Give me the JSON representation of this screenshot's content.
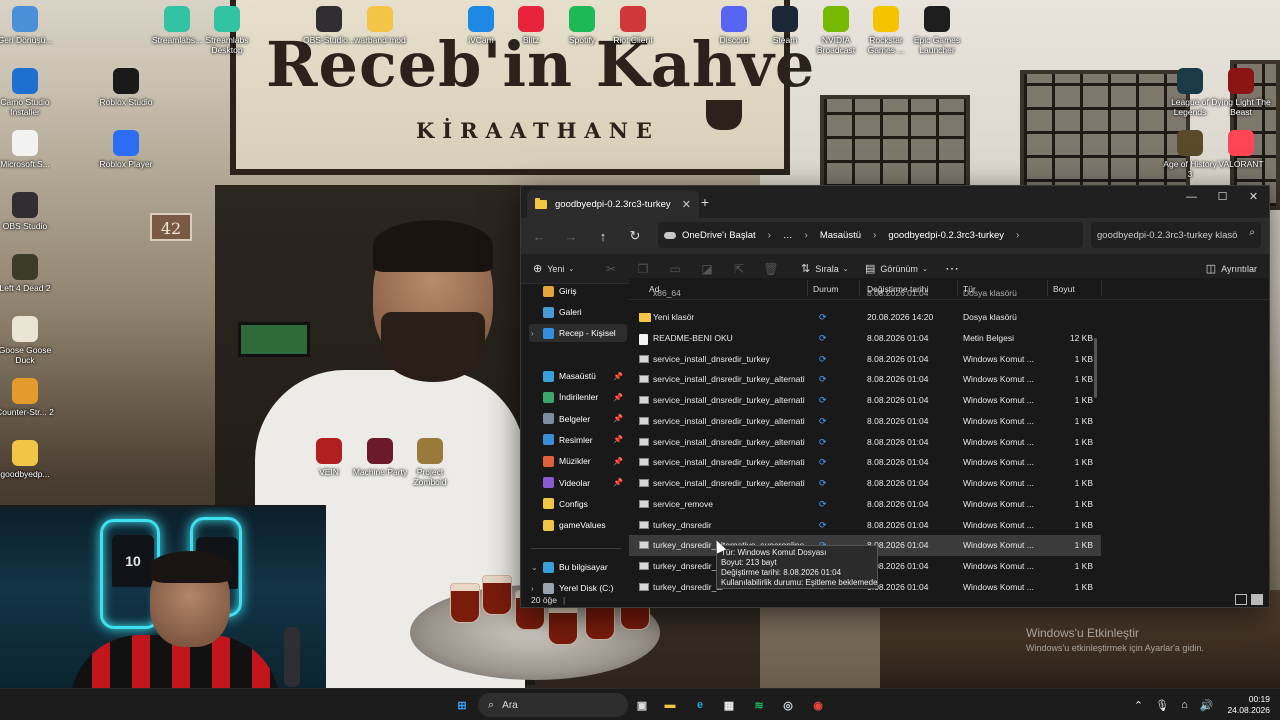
{
  "desktop": {
    "icons_left": [
      {
        "label": "Geri Dönüşü...",
        "icon": "recycle-bin-icon",
        "color": "#4a90d9"
      },
      {
        "label": "Camo Studio Installer",
        "icon": "download-icon",
        "color": "#1f6fd1"
      },
      {
        "label": "Microsoft.S...",
        "icon": "document-icon",
        "color": "#f2f2f2"
      },
      {
        "label": "OBS Studio",
        "icon": "obs-icon",
        "color": "#302e31"
      },
      {
        "label": "Left 4 Dead 2",
        "icon": "left4dead-icon",
        "color": "#3c3c2a"
      },
      {
        "label": "Goose Goose Duck",
        "icon": "goose-icon",
        "color": "#e9e4d3"
      },
      {
        "label": "Counter-Str... 2",
        "icon": "counter-strike-icon",
        "color": "#e39b2b"
      },
      {
        "label": "goodbyedp...",
        "icon": "folder-icon",
        "color": "#f2c546"
      }
    ],
    "icons_col2": [
      {
        "label": "Roblox Studio",
        "icon": "roblox-studio-icon",
        "color": "#1a1a1a"
      },
      {
        "label": "Roblox Player",
        "icon": "roblox-player-icon",
        "color": "#2d6cf5"
      }
    ],
    "icons_top": [
      {
        "label": "Streamlabs...",
        "icon": "streamlabs-icon",
        "color": "#31c3a2"
      },
      {
        "label": "Streamlabs Desktop",
        "icon": "streamlabs-desktop-icon",
        "color": "#31c3a2"
      },
      {
        "label": "OBS-Studio...",
        "icon": "obs-icon",
        "color": "#302e31"
      },
      {
        "label": "warband mod",
        "icon": "folder-icon",
        "color": "#f2c546"
      },
      {
        "label": "iVCam",
        "icon": "ivcam-icon",
        "color": "#1e88e5"
      },
      {
        "label": "Blitz",
        "icon": "blitz-icon",
        "color": "#e8233c"
      },
      {
        "label": "Spotify",
        "icon": "spotify-icon",
        "color": "#1db954"
      },
      {
        "label": "Riot Client",
        "icon": "riot-icon",
        "color": "#d13639"
      },
      {
        "label": "Discord",
        "icon": "discord-icon",
        "color": "#5865f2"
      },
      {
        "label": "Steam",
        "icon": "steam-icon",
        "color": "#1b2838"
      },
      {
        "label": "NVIDIA Broadcast",
        "icon": "nvidia-icon",
        "color": "#76b900"
      },
      {
        "label": "Rockstar Games ...",
        "icon": "rockstar-icon",
        "color": "#f5c400"
      },
      {
        "label": "Epic Games Launcher",
        "icon": "epic-games-icon",
        "color": "#1e1e1e"
      }
    ],
    "icons_right": [
      {
        "label": "League of Legends",
        "icon": "league-icon",
        "color": "#1a3a4a"
      },
      {
        "label": "Dying Light The Beast",
        "icon": "dying-light-icon",
        "color": "#8b1414"
      },
      {
        "label": "Age of History 3",
        "icon": "age-of-history-icon",
        "color": "#5a4a2a"
      },
      {
        "label": "VALORANT",
        "icon": "valorant-icon",
        "color": "#fd4556"
      }
    ],
    "icons_middle": [
      {
        "label": "VEIN",
        "icon": "vein-icon",
        "color": "#b21f1f"
      },
      {
        "label": "Machine Party",
        "icon": "machine-party-icon",
        "color": "#6a1a2a"
      },
      {
        "label": "Project Zomboid",
        "icon": "project-zomboid-icon",
        "color": "#9a7a3a"
      }
    ]
  },
  "wallpaper": {
    "sign_title": "Receb'in Kahve",
    "sign_subtitle": "KİRAATHANE",
    "door_number": "42"
  },
  "explorer": {
    "tab_title": "goodbyedpi-0.2.3rc3-turkey",
    "window_controls": {
      "minimize": "—",
      "maximize": "☐",
      "close": "✕"
    },
    "breadcrumb": [
      "OneDrive'ı Başlat",
      "…",
      "Masaüstü",
      "goodbyedpi-0.2.3rc3-turkey"
    ],
    "search_placeholder": "goodbyedpi-0.2.3rc3-turkey klasö",
    "commands": {
      "new": "Yeni",
      "sort": "Sırala",
      "view": "Görünüm",
      "more": "⋯",
      "details": "Ayrıntılar"
    },
    "sidebar": {
      "top": [
        {
          "label": "Giriş",
          "icon": "home-icon",
          "color": "#e2a33a"
        },
        {
          "label": "Galeri",
          "icon": "gallery-icon",
          "color": "#4a9ad8"
        },
        {
          "label": "Recep - Kişisel",
          "icon": "onedrive-icon",
          "color": "#2f8ee0"
        }
      ],
      "quick": [
        {
          "label": "Masaüstü",
          "icon": "desktop-icon",
          "color": "#3aa1d8",
          "pinned": true
        },
        {
          "label": "İndirilenler",
          "icon": "download-icon",
          "color": "#3aa86a",
          "pinned": true
        },
        {
          "label": "Belgeler",
          "icon": "documents-icon",
          "color": "#7b8da0",
          "pinned": true
        },
        {
          "label": "Resimler",
          "icon": "pictures-icon",
          "color": "#3c8fd6",
          "pinned": true
        },
        {
          "label": "Müzikler",
          "icon": "music-icon",
          "color": "#e0603a",
          "pinned": true
        },
        {
          "label": "Videolar",
          "icon": "videos-icon",
          "color": "#8a5ad0",
          "pinned": true
        },
        {
          "label": "Configs",
          "icon": "folder-icon",
          "color": "#f2c546",
          "pinned": false
        },
        {
          "label": "gameValues",
          "icon": "folder-icon",
          "color": "#f2c546",
          "pinned": false
        }
      ],
      "bottom": [
        {
          "label": "Bu bilgisayar",
          "icon": "computer-icon",
          "color": "#3aa1d8"
        },
        {
          "label": "Yerel Disk (C:)",
          "icon": "drive-icon",
          "color": "#9aa4ae"
        }
      ]
    },
    "columns": {
      "name": "Ad",
      "status": "Durum",
      "modified": "Değiştirme tarihi",
      "type": "Tür",
      "size": "Boyut"
    },
    "partial_row": {
      "name": "x86_64",
      "modified": "8.08.2026 01:04",
      "type": "Dosya klasörü"
    },
    "files": [
      {
        "name": "Yeni klasör",
        "kind": "folder",
        "modified": "20.08.2026 14:20",
        "type": "Dosya klasörü",
        "size": ""
      },
      {
        "name": "README-BENI OKU",
        "kind": "txt",
        "modified": "8.08.2026 01:04",
        "type": "Metin Belgesi",
        "size": "12 KB"
      },
      {
        "name": "service_install_dnsredir_turkey",
        "kind": "bat",
        "modified": "8.08.2026 01:04",
        "type": "Windows Komut ...",
        "size": "1 KB"
      },
      {
        "name": "service_install_dnsredir_turkey_alternativ...",
        "kind": "bat",
        "modified": "8.08.2026 01:04",
        "type": "Windows Komut ...",
        "size": "1 KB"
      },
      {
        "name": "service_install_dnsredir_turkey_alternativ...",
        "kind": "bat",
        "modified": "8.08.2026 01:04",
        "type": "Windows Komut ...",
        "size": "1 KB"
      },
      {
        "name": "service_install_dnsredir_turkey_alternativ...",
        "kind": "bat",
        "modified": "8.08.2026 01:04",
        "type": "Windows Komut ...",
        "size": "1 KB"
      },
      {
        "name": "service_install_dnsredir_turkey_alternativ...",
        "kind": "bat",
        "modified": "8.08.2026 01:04",
        "type": "Windows Komut ...",
        "size": "1 KB"
      },
      {
        "name": "service_install_dnsredir_turkey_alternativ...",
        "kind": "bat",
        "modified": "8.08.2026 01:04",
        "type": "Windows Komut ...",
        "size": "1 KB"
      },
      {
        "name": "service_install_dnsredir_turkey_alternativ...",
        "kind": "bat",
        "modified": "8.08.2026 01:04",
        "type": "Windows Komut ...",
        "size": "1 KB"
      },
      {
        "name": "service_remove",
        "kind": "bat",
        "modified": "8.08.2026 01:04",
        "type": "Windows Komut ...",
        "size": "1 KB"
      },
      {
        "name": "turkey_dnsredir",
        "kind": "bat",
        "modified": "8.08.2026 01:04",
        "type": "Windows Komut ...",
        "size": "1 KB"
      },
      {
        "name": "turkey_dnsredir_alternative_superonline",
        "kind": "bat",
        "modified": "8.08.2026 01:04",
        "type": "Windows Komut ...",
        "size": "1 KB",
        "selected": true
      },
      {
        "name": "turkey_dnsredir_al",
        "kind": "bat",
        "modified": "8.08.2026 01:04",
        "type": "Windows Komut ...",
        "size": "1 KB"
      },
      {
        "name": "turkey_dnsredir_al",
        "kind": "bat",
        "modified": "8.08.2026 01:04",
        "type": "Windows Komut ...",
        "size": "1 KB"
      }
    ],
    "tooltip": [
      "Tür: Windows Komut Dosyası",
      "Boyut: 213 bayt",
      "Değiştirme tarihi: 8.08.2026 01:04",
      "Kullanılabilirlik durumu: Eşitleme beklemede"
    ],
    "status": "20 öğe"
  },
  "activation": {
    "title": "Windows'u Etkinleştir",
    "subtitle": "Windows'u etkinleştirmek için Ayarlar'a gidin."
  },
  "taskbar": {
    "search_placeholder": "Ara",
    "time": "00:19",
    "date": "24.08.2026",
    "apps": [
      {
        "name": "start-button",
        "icon": "windows-logo-icon",
        "color": "#3aa1ff"
      },
      {
        "name": "task-view",
        "icon": "task-view-icon",
        "color": "#ddd"
      },
      {
        "name": "file-explorer",
        "icon": "folder-icon",
        "color": "#f2c546"
      },
      {
        "name": "edge",
        "icon": "edge-icon",
        "color": "#2ba3d8"
      },
      {
        "name": "microsoft-store",
        "icon": "store-icon",
        "color": "#eee"
      },
      {
        "name": "spotify",
        "icon": "spotify-icon",
        "color": "#1db954"
      },
      {
        "name": "steam",
        "icon": "steam-icon",
        "color": "#cfd8e0"
      },
      {
        "name": "chrome",
        "icon": "chrome-icon",
        "color": "#e8453c"
      }
    ]
  }
}
